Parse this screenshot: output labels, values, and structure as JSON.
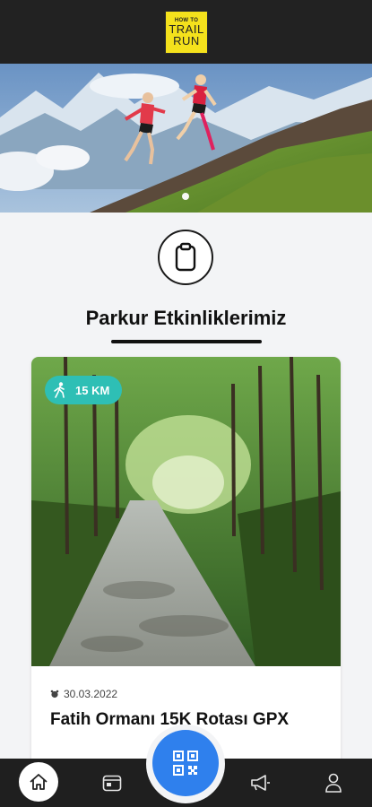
{
  "header": {
    "logo_line1": "HOW TO",
    "logo_line2": "TRAIL",
    "logo_line3": "RUN"
  },
  "hero": {
    "carousel_pages": 1,
    "active_page": 1
  },
  "section": {
    "icon": "clipboard-icon",
    "title": "Parkur Etkinliklerimiz"
  },
  "card": {
    "badge_icon": "walking-icon",
    "badge_label": "15 KM",
    "date_icon": "alarm-clock-icon",
    "date": "30.03.2022",
    "title": "Fatih Ormanı 15K Rotası GPX"
  },
  "bottom_nav": {
    "items": [
      {
        "icon": "home-icon",
        "active": true
      },
      {
        "icon": "calendar-icon",
        "active": false
      },
      {
        "icon": "qr-code-icon",
        "active": false
      },
      {
        "icon": "megaphone-icon",
        "active": false
      },
      {
        "icon": "user-icon",
        "active": false
      }
    ]
  },
  "colors": {
    "header_bg": "#222222",
    "logo_yellow": "#f4e11c",
    "badge_teal": "#2ebfb5",
    "qr_blue": "#2f80ed",
    "page_bg": "#f3f4f6"
  }
}
